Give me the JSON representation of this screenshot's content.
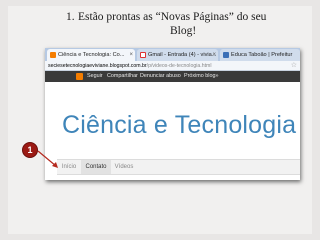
{
  "slide": {
    "item_number": "1.",
    "title_line1": "Estão prontas as “Novas Páginas”  do seu",
    "title_line2": "Blog!"
  },
  "browser": {
    "tabs": [
      {
        "label": "Ciência e Tecnologia: Co...",
        "icon": "blogger-icon",
        "active": true
      },
      {
        "label": "Gmail - Entrada (4) - vivia...",
        "icon": "gmail-icon",
        "active": false
      },
      {
        "label": "Educa Taboão | Prefeitur",
        "icon": "educa-icon",
        "active": false
      }
    ],
    "url_host": "seciesetecnologiaeviviane.blogspot.com.br",
    "url_path": "/p/videos-de-tecnologia.html"
  },
  "blogger_bar": {
    "links": [
      "Seguir",
      "Compartilhar",
      "Denunciar abuso",
      "Próximo blog»"
    ]
  },
  "blog": {
    "title": "Ciência e Tecnologia",
    "nav": [
      {
        "label": "Início",
        "selected": false
      },
      {
        "label": "Contato",
        "selected": true
      },
      {
        "label": "Vídeos",
        "selected": false
      }
    ]
  },
  "callout": {
    "number": "1"
  },
  "colors": {
    "blog_title": "#3f85b9",
    "callout": "#9b1a14",
    "blogger_bar": "#3a3a3a"
  }
}
